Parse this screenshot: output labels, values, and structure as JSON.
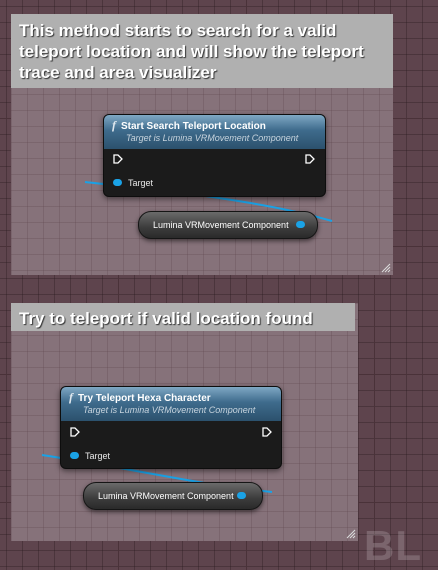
{
  "comments": [
    {
      "text": "This method starts to search for a valid teleport location and will show the teleport trace and area visualizer"
    },
    {
      "text": "Try to teleport if valid location found"
    }
  ],
  "nodes": [
    {
      "title": "Start Search Teleport Location",
      "subtitle": "Target is Lumina VRMovement Component",
      "pin_label": "Target"
    },
    {
      "title": "Try Teleport Hexa Character",
      "subtitle": "Target is Lumina VRMovement Component",
      "pin_label": "Target"
    }
  ],
  "variables": [
    {
      "label": "Lumina VRMovement Component"
    },
    {
      "label": "Lumina VRMovement Component"
    }
  ],
  "icons": {
    "function": "f",
    "watermark": "BL"
  },
  "colors": {
    "wire": "#1aa2e6",
    "header_blue": "#3e6b8c",
    "comment_bg": "#86727a"
  }
}
